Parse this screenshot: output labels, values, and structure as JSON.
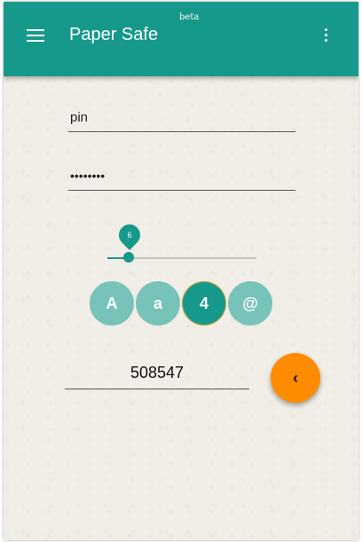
{
  "app_bar": {
    "title": "Paper Safe",
    "badge": "beta",
    "menu_icon": "hamburger-menu-icon",
    "overflow_icon": "more-vert-icon",
    "color": "#16998a"
  },
  "form": {
    "name_value": "pin",
    "password_value": "••••••••"
  },
  "length_slider": {
    "value": "6",
    "fraction": 0.14
  },
  "charset_toggles": [
    {
      "label": "A",
      "active": false
    },
    {
      "label": "a",
      "active": false
    },
    {
      "label": "4",
      "active": true
    },
    {
      "label": "@",
      "active": false
    }
  ],
  "result": {
    "value": "508547"
  },
  "fab": {
    "label": "‹",
    "icon": "chevron-left-icon",
    "color": "#ff8c00"
  }
}
